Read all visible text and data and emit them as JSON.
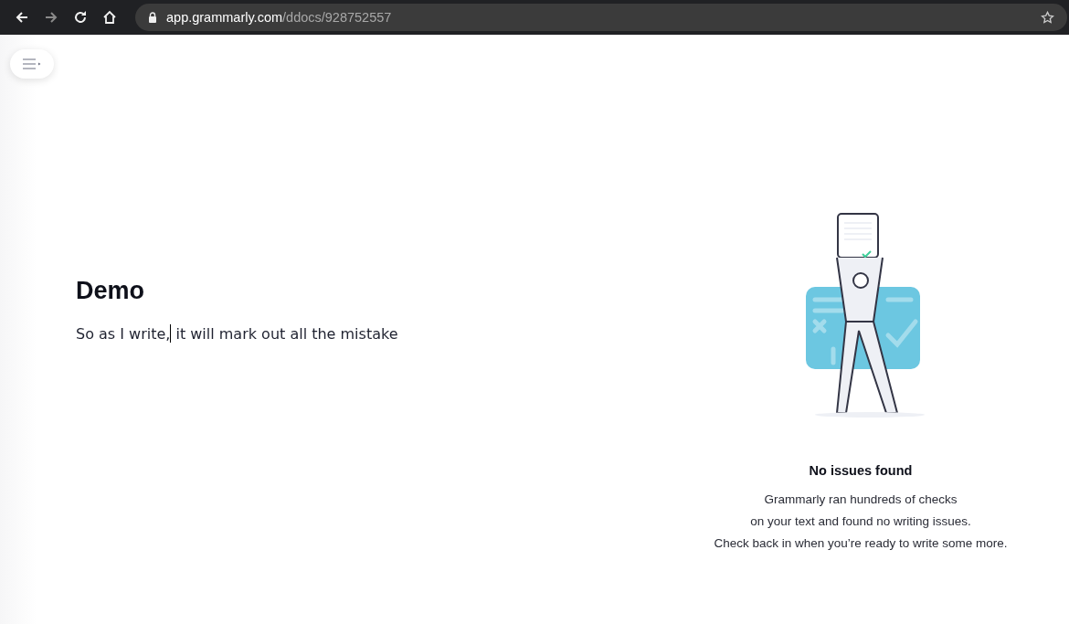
{
  "browser": {
    "nav_buttons": [
      {
        "kind": "back",
        "disabled": false
      },
      {
        "kind": "forward",
        "disabled": true
      },
      {
        "kind": "reload",
        "disabled": false
      },
      {
        "kind": "home",
        "disabled": false
      }
    ],
    "address": {
      "domain": "app.grammarly.com",
      "path": "/ddocs/928752557"
    }
  },
  "document": {
    "title": "Demo",
    "text_before_cursor": "So as I write,",
    "text_after_cursor": " it will mark out all the mistake"
  },
  "assistant": {
    "title": "No issues found",
    "description": [
      "Grammarly ran hundreds of checks",
      "on your text and found no writing issues.",
      "Check back in when you’re ready to write some more."
    ]
  }
}
